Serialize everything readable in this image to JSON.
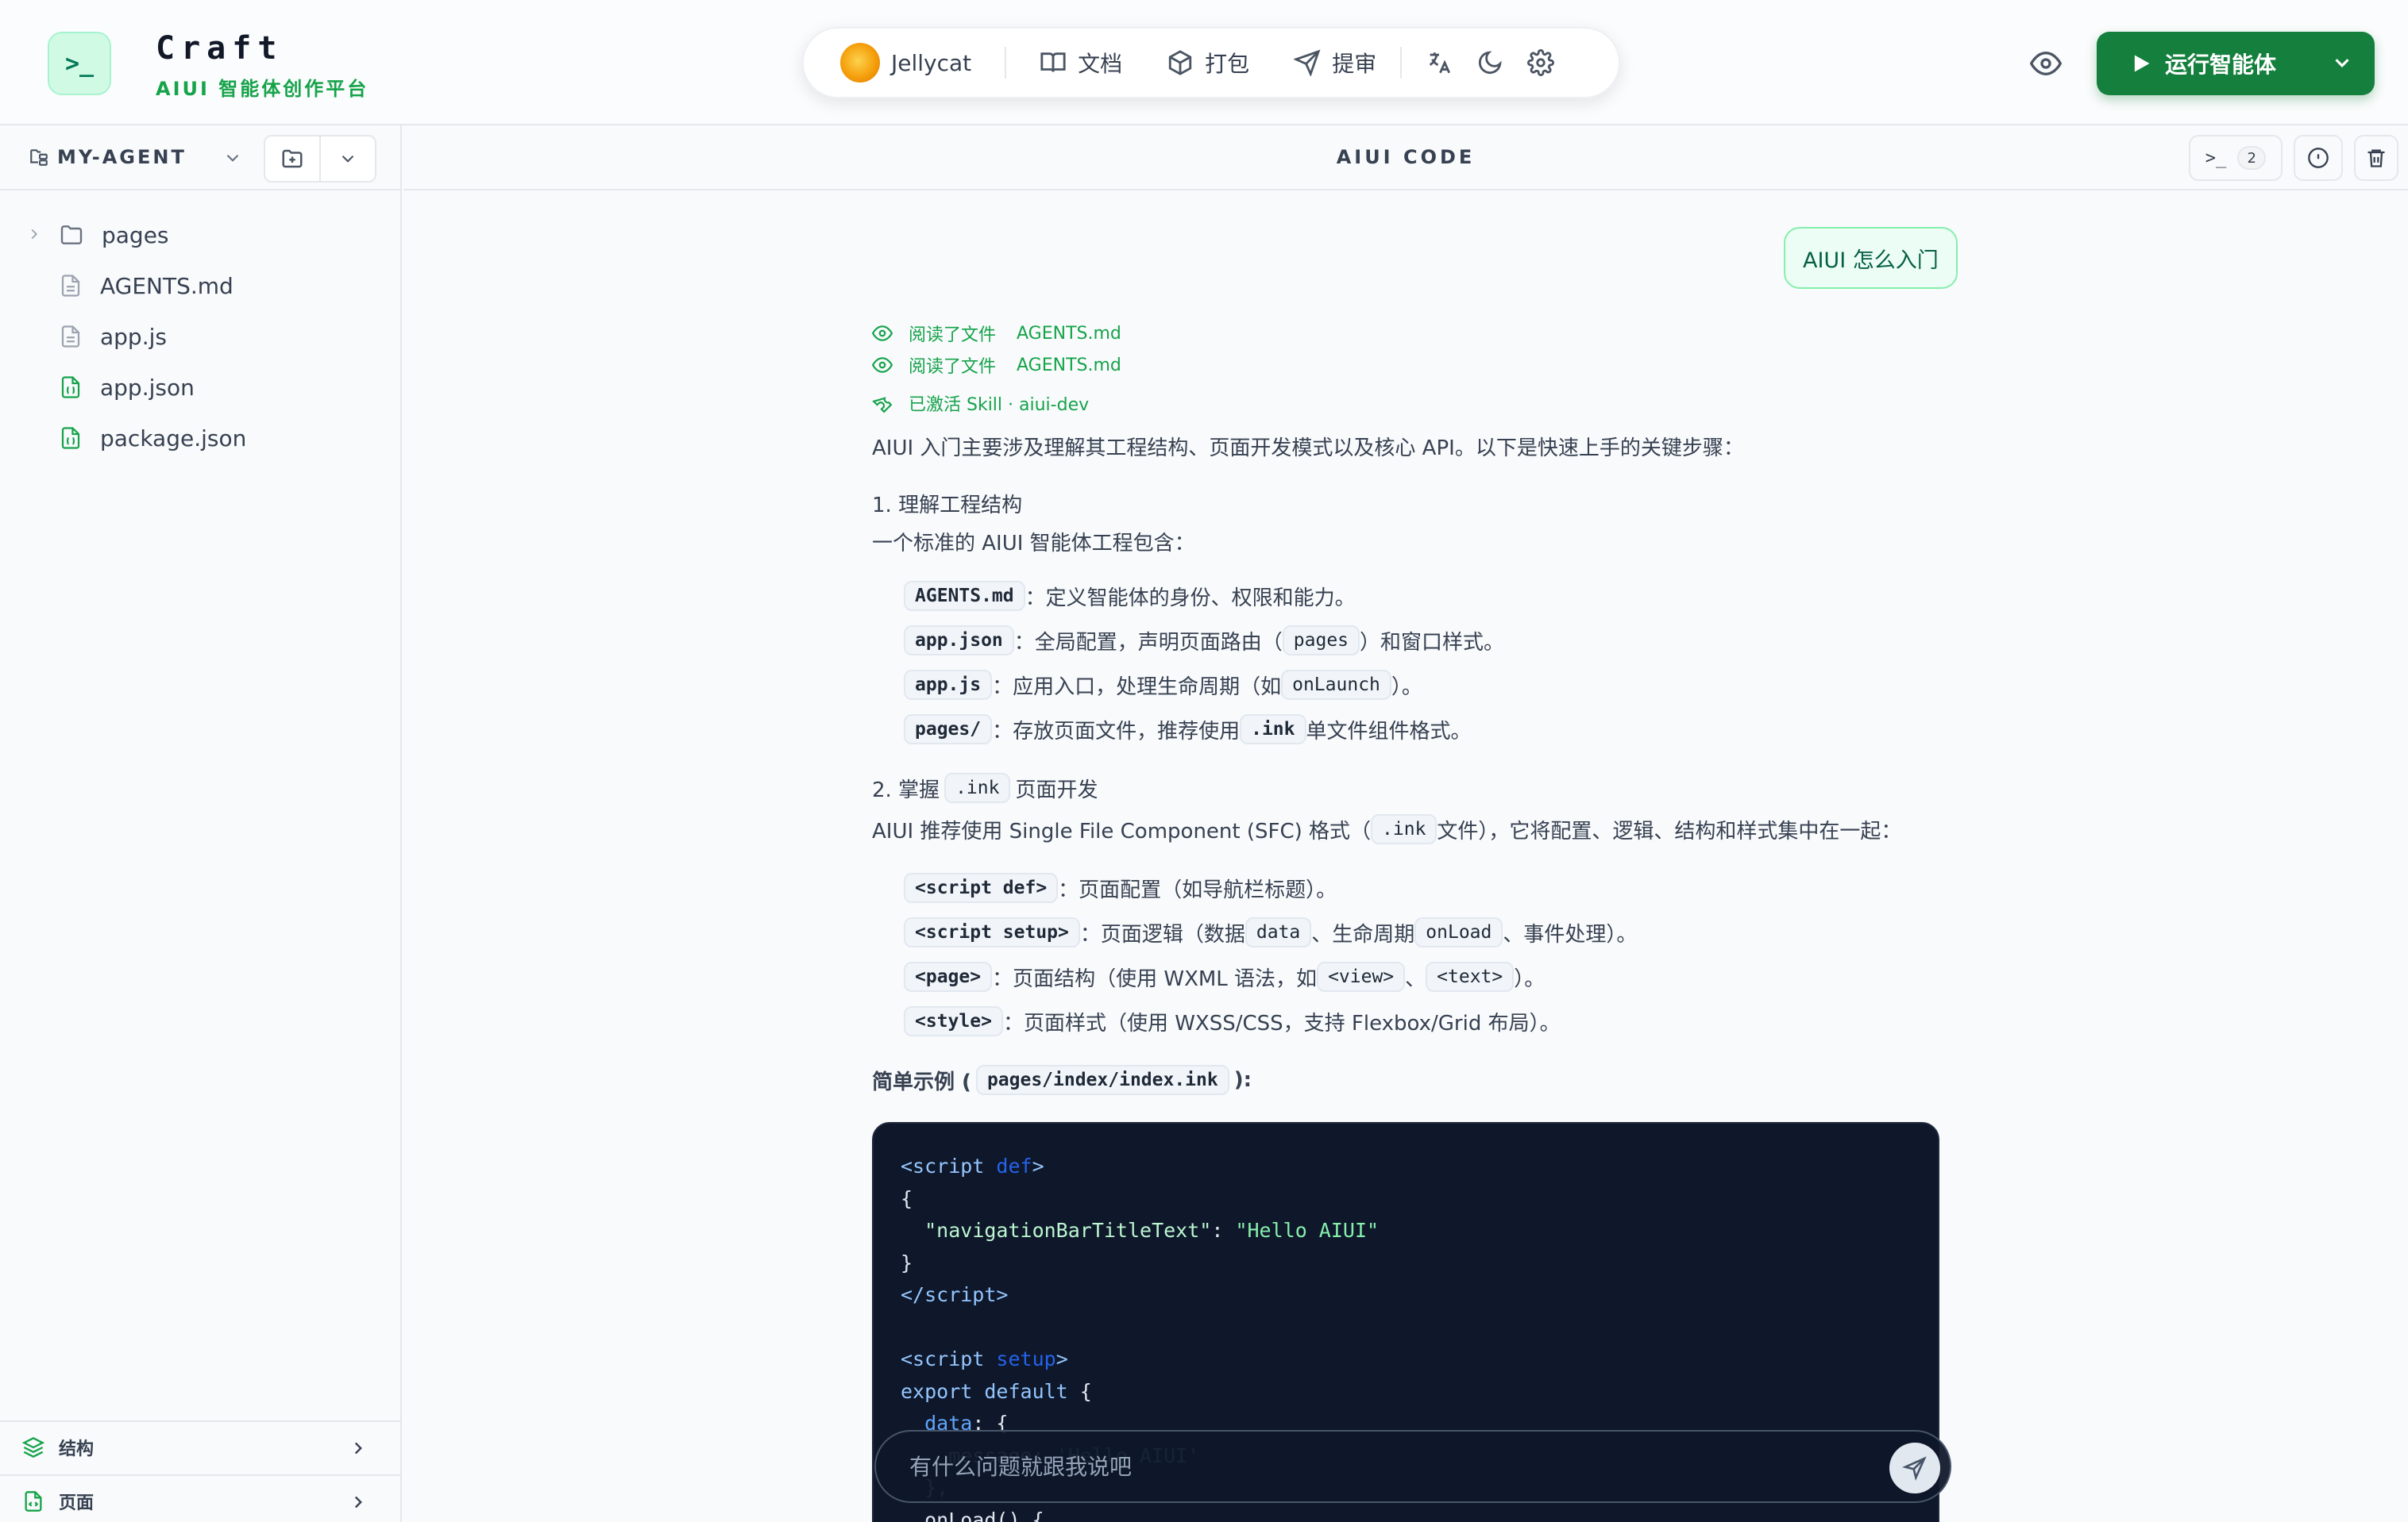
{
  "header": {
    "brand_title": "Craft",
    "brand_subtitle": "AIUI 智能体创作平台",
    "logo_glyph": ">_",
    "toolbar": {
      "user_name": "Jellycat",
      "docs_label": "文档",
      "pack_label": "打包",
      "review_label": "提审"
    },
    "run_button_label": "运行智能体"
  },
  "sidebar": {
    "project_name": "MY-AGENT",
    "tree": [
      {
        "name": "pages",
        "type": "folder"
      },
      {
        "name": "AGENTS.md",
        "type": "file"
      },
      {
        "name": "app.js",
        "type": "file"
      },
      {
        "name": "app.json",
        "type": "json"
      },
      {
        "name": "package.json",
        "type": "json"
      }
    ],
    "footer": {
      "structure_label": "结构",
      "pages_label": "页面"
    }
  },
  "main": {
    "title": "AIUI CODE",
    "terminal_count": "2"
  },
  "chat": {
    "user_message": "AIUI 怎么入门",
    "activities": [
      {
        "action": "阅读了文件",
        "file": "AGENTS.md"
      },
      {
        "action": "阅读了文件",
        "file": "AGENTS.md"
      },
      {
        "action": "已激活 Skill · aiui-dev",
        "file": ""
      }
    ],
    "intro": "AIUI 入门主要涉及理解其工程结构、页面开发模式以及核心 API。以下是快速上手的关键步骤：",
    "section1": {
      "heading": "1. 理解工程结构",
      "desc": "一个标准的 AIUI 智能体工程包含：",
      "items": [
        {
          "code": "AGENTS.md",
          "text": "：定义智能体的身份、权限和能力。"
        },
        {
          "code": "app.json",
          "text_a": "：全局配置，声明页面路由（",
          "code2": "pages",
          "text_b": "）和窗口样式。"
        },
        {
          "code": "app.js",
          "text_a": "：应用入口，处理生命周期（如",
          "code2": "onLaunch",
          "text_b": "）。"
        },
        {
          "code": "pages/",
          "text_a": "：存放页面文件，推荐使用",
          "code2": ".ink",
          "text_b": "单文件组件格式。"
        }
      ]
    },
    "section2": {
      "heading_a": "2. 掌握",
      "heading_code": ".ink",
      "heading_b": "页面开发",
      "desc_a": "AIUI 推荐使用 Single File Component (SFC) 格式（",
      "desc_code": ".ink",
      "desc_b": "文件），它将配置、逻辑、结构和样式集中在一起：",
      "items": [
        {
          "code": "<script def>",
          "text": "：页面配置（如导航栏标题）。"
        },
        {
          "code": "<script setup>",
          "text_a": "：页面逻辑（数据",
          "code2": "data",
          "text_b": "、生命周期",
          "code3": "onLoad",
          "text_c": "、事件处理）。"
        },
        {
          "code": "<page>",
          "text_a": "：页面结构（使用 WXML 语法，如",
          "code2": "<view>",
          "text_b": "、",
          "code3": "<text>",
          "text_c": "）。"
        },
        {
          "code": "<style>",
          "text": "：页面样式（使用 WXSS/CSS，支持 Flexbox/Grid 布局）。"
        }
      ]
    },
    "example": {
      "label_a": "简单示例 (",
      "label_code": "pages/index/index.ink",
      "label_b": "):"
    },
    "input_placeholder": "有什么问题就跟我说吧"
  },
  "colors": {
    "accent_green": "#15803d",
    "activity_green": "#16a34a",
    "code_bg": "#0f172a"
  }
}
